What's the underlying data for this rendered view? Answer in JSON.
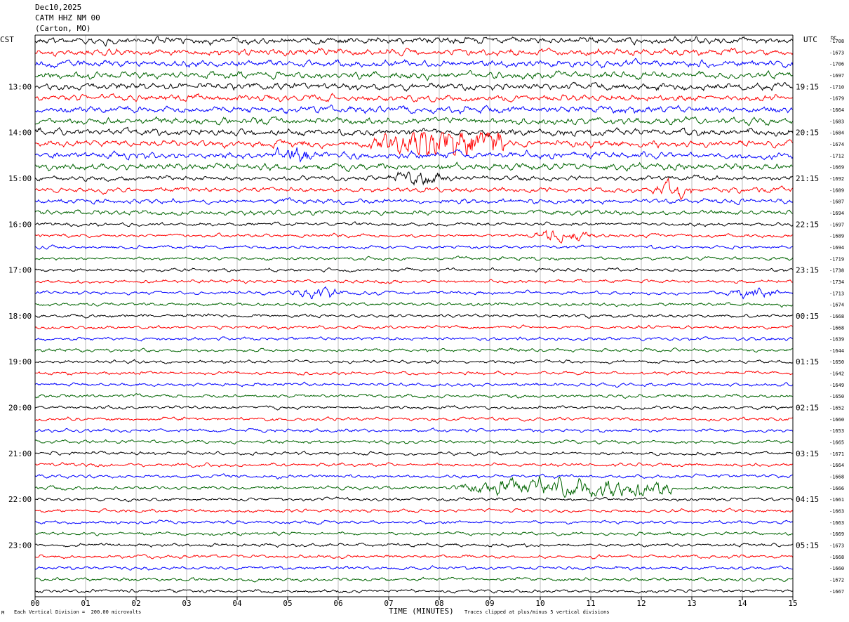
{
  "header": {
    "date": "Dec10,2025",
    "station": "CATM HHZ NM 00",
    "location": "(Carton, MO)"
  },
  "left_timezone": "CST",
  "right_timezone": "UTC",
  "dc_label": "DC",
  "footer": {
    "scale_note": "Each Vertical Division =  200.00 microvolts",
    "clip_note": "Traces clipped at plus/minus 5 vertical divisions",
    "corner_mark": "M"
  },
  "chart_data": {
    "type": "line",
    "xlabel": "TIME (MINUTES)",
    "xlim": [
      0,
      15
    ],
    "x_ticks": [
      "00",
      "01",
      "02",
      "03",
      "04",
      "05",
      "06",
      "07",
      "08",
      "09",
      "10",
      "11",
      "12",
      "13",
      "14",
      "15"
    ],
    "trace_colors": [
      "#000000",
      "#ff0000",
      "#0000ff",
      "#006400"
    ],
    "left_hour_labels": [
      "13:00",
      "14:00",
      "15:00",
      "16:00",
      "17:00",
      "18:00",
      "19:00",
      "20:00",
      "21:00",
      "22:00",
      "23:00"
    ],
    "right_hour_labels": [
      "19:15",
      "20:15",
      "21:15",
      "22:15",
      "23:15",
      "00:15",
      "01:15",
      "02:15",
      "03:15",
      "04:15",
      "05:15"
    ],
    "hour_label_first_trace": 4,
    "traces_per_hour": 4,
    "dc_values": [
      -1708,
      -1673,
      -1706,
      -1697,
      -1710,
      -1679,
      -1664,
      -1683,
      -1684,
      -1674,
      -1712,
      -1669,
      -1692,
      -1689,
      -1687,
      -1694,
      -1697,
      -1689,
      -1694,
      -1719,
      -1738,
      -1734,
      -1713,
      -1674,
      -1668,
      -1668,
      -1639,
      -1644,
      -1650,
      -1642,
      -1649,
      -1650,
      -1652,
      -1660,
      -1653,
      -1665,
      -1671,
      -1664,
      -1668,
      -1666,
      -1661,
      -1663,
      -1663,
      -1669,
      -1673,
      -1668,
      -1660,
      -1672,
      -1667
    ],
    "events": [
      {
        "trace": 9,
        "start_min": 6.2,
        "end_min": 9.3,
        "peak_min": 8.2
      },
      {
        "trace": 10,
        "start_min": 4.4,
        "end_min": 5.4,
        "peak_min": 5.2
      },
      {
        "trace": 12,
        "start_min": 6.9,
        "end_min": 8.2,
        "peak_min": 7.6
      },
      {
        "trace": 13,
        "start_min": 12.1,
        "end_min": 13.0,
        "peak_min": 12.6
      },
      {
        "trace": 17,
        "start_min": 9.9,
        "end_min": 11.3,
        "peak_min": 10.4
      },
      {
        "trace": 22,
        "start_min": 5.0,
        "end_min": 6.2,
        "peak_min": 5.6
      },
      {
        "trace": 22,
        "start_min": 13.7,
        "end_min": 14.8,
        "peak_min": 14.2
      },
      {
        "trace": 39,
        "start_min": 7.5,
        "end_min": 12.6,
        "peak_min": 10.8
      }
    ]
  }
}
